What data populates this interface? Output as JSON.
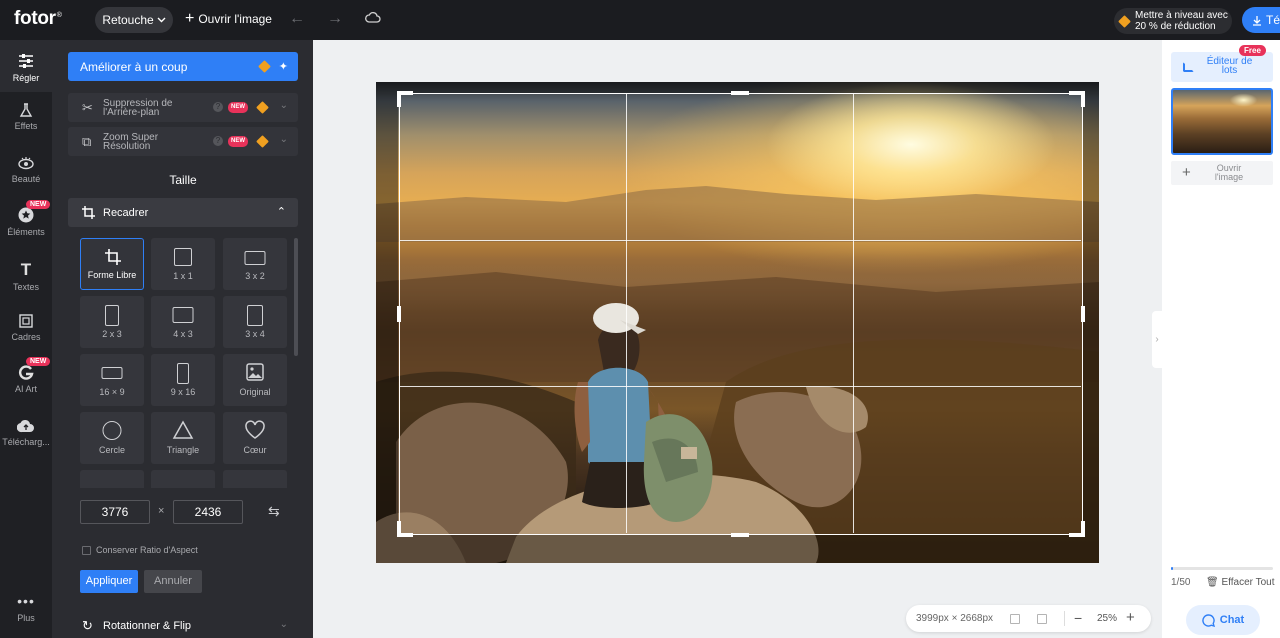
{
  "topbar": {
    "logo": "fotor",
    "logo_mark": "®",
    "mode_label": "Retouche",
    "open_image": "Ouvrir l'image",
    "upgrade_line1": "Mettre à niveau avec",
    "upgrade_line2": "20 % de réduction",
    "download_label": "Té"
  },
  "nav": [
    {
      "label": "Régler",
      "icon": "sliders-icon"
    },
    {
      "label": "Effets",
      "icon": "flask-icon"
    },
    {
      "label": "Beauté",
      "icon": "eye-icon"
    },
    {
      "label": "Éléments",
      "icon": "star-icon",
      "badge": "NEW"
    },
    {
      "label": "Textes",
      "icon": "text-icon"
    },
    {
      "label": "Cadres",
      "icon": "frame-icon"
    },
    {
      "label": "AI Art",
      "icon": "ai-art-icon",
      "badge": "NEW"
    },
    {
      "label": "Télécharg...",
      "icon": "upload-cloud-icon"
    },
    {
      "label": "Plus",
      "icon": "more-icon"
    }
  ],
  "panel": {
    "improve": "Améliorer à un coup",
    "tools": [
      {
        "line1": "Suppression de",
        "line2": "l'Arrière-plan",
        "badge": "NEW"
      },
      {
        "line1": "Zoom Super",
        "line2": "Résolution",
        "badge": "NEW"
      }
    ],
    "section": "Taille",
    "crop_header": "Recadrer",
    "crop_options": [
      "Forme Libre",
      "1 x 1",
      "3 x 2",
      "2 x 3",
      "4 x 3",
      "3 x 4",
      "16 × 9",
      "9 x 16",
      "Original",
      "Cercle",
      "Triangle",
      "Cœur"
    ],
    "width": "3776",
    "times": "×",
    "height": "2436",
    "keep_ratio": "Conserver Ratio d'Aspect",
    "apply": "Appliquer",
    "cancel": "Annuler",
    "rotate": "Rotationner & Flip"
  },
  "canvas": {
    "dimensions": "3999px × 2668px",
    "zoom": "25%"
  },
  "right": {
    "batch_line1": "Éditeur de",
    "batch_line2": "lots",
    "free_badge": "Free",
    "open_line1": "Ouvrir",
    "open_line2": "l'image",
    "count": "1/50",
    "clear": "Effacer Tout",
    "chat": "Chat",
    "progress": 0.02
  },
  "colors": {
    "accent": "#2f7ff6",
    "new_badge": "#e8325a",
    "premium": "#f0a020"
  }
}
